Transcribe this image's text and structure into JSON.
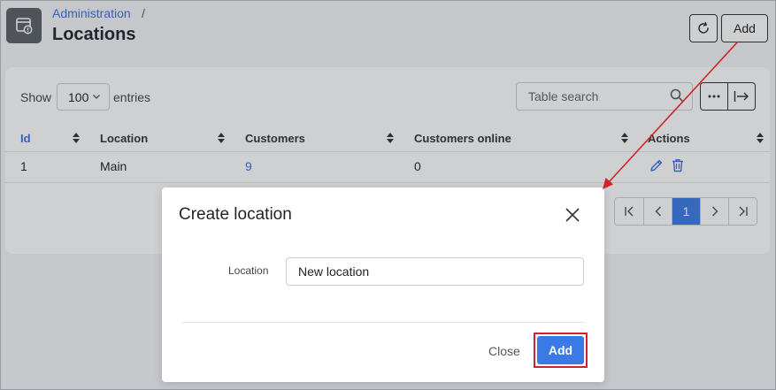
{
  "header": {
    "breadcrumb": "Administration",
    "breadcrumb_separator": "/",
    "title": "Locations",
    "add_label": "Add"
  },
  "toolbar": {
    "show_label": "Show",
    "entries_value": "100",
    "entries_label": "entries",
    "search_placeholder": "Table search"
  },
  "table": {
    "columns": [
      "Id",
      "Location",
      "Customers",
      "Customers online",
      "Actions"
    ],
    "rows": [
      {
        "id": "1",
        "location": "Main",
        "customers": "9",
        "customers_online": "0"
      }
    ]
  },
  "pagination": {
    "current_page": "1"
  },
  "modal": {
    "title": "Create location",
    "field_label": "Location",
    "field_value": "New location",
    "close_label": "Close",
    "add_label": "Add"
  },
  "colors": {
    "accent": "#3b7ae6",
    "link": "#3e6fd6",
    "annotation": "#d0222a"
  },
  "icons": [
    "admin-panel-icon",
    "refresh-icon",
    "search-icon",
    "more-icon",
    "export-icon",
    "edit-icon",
    "trash-icon",
    "close-icon"
  ]
}
